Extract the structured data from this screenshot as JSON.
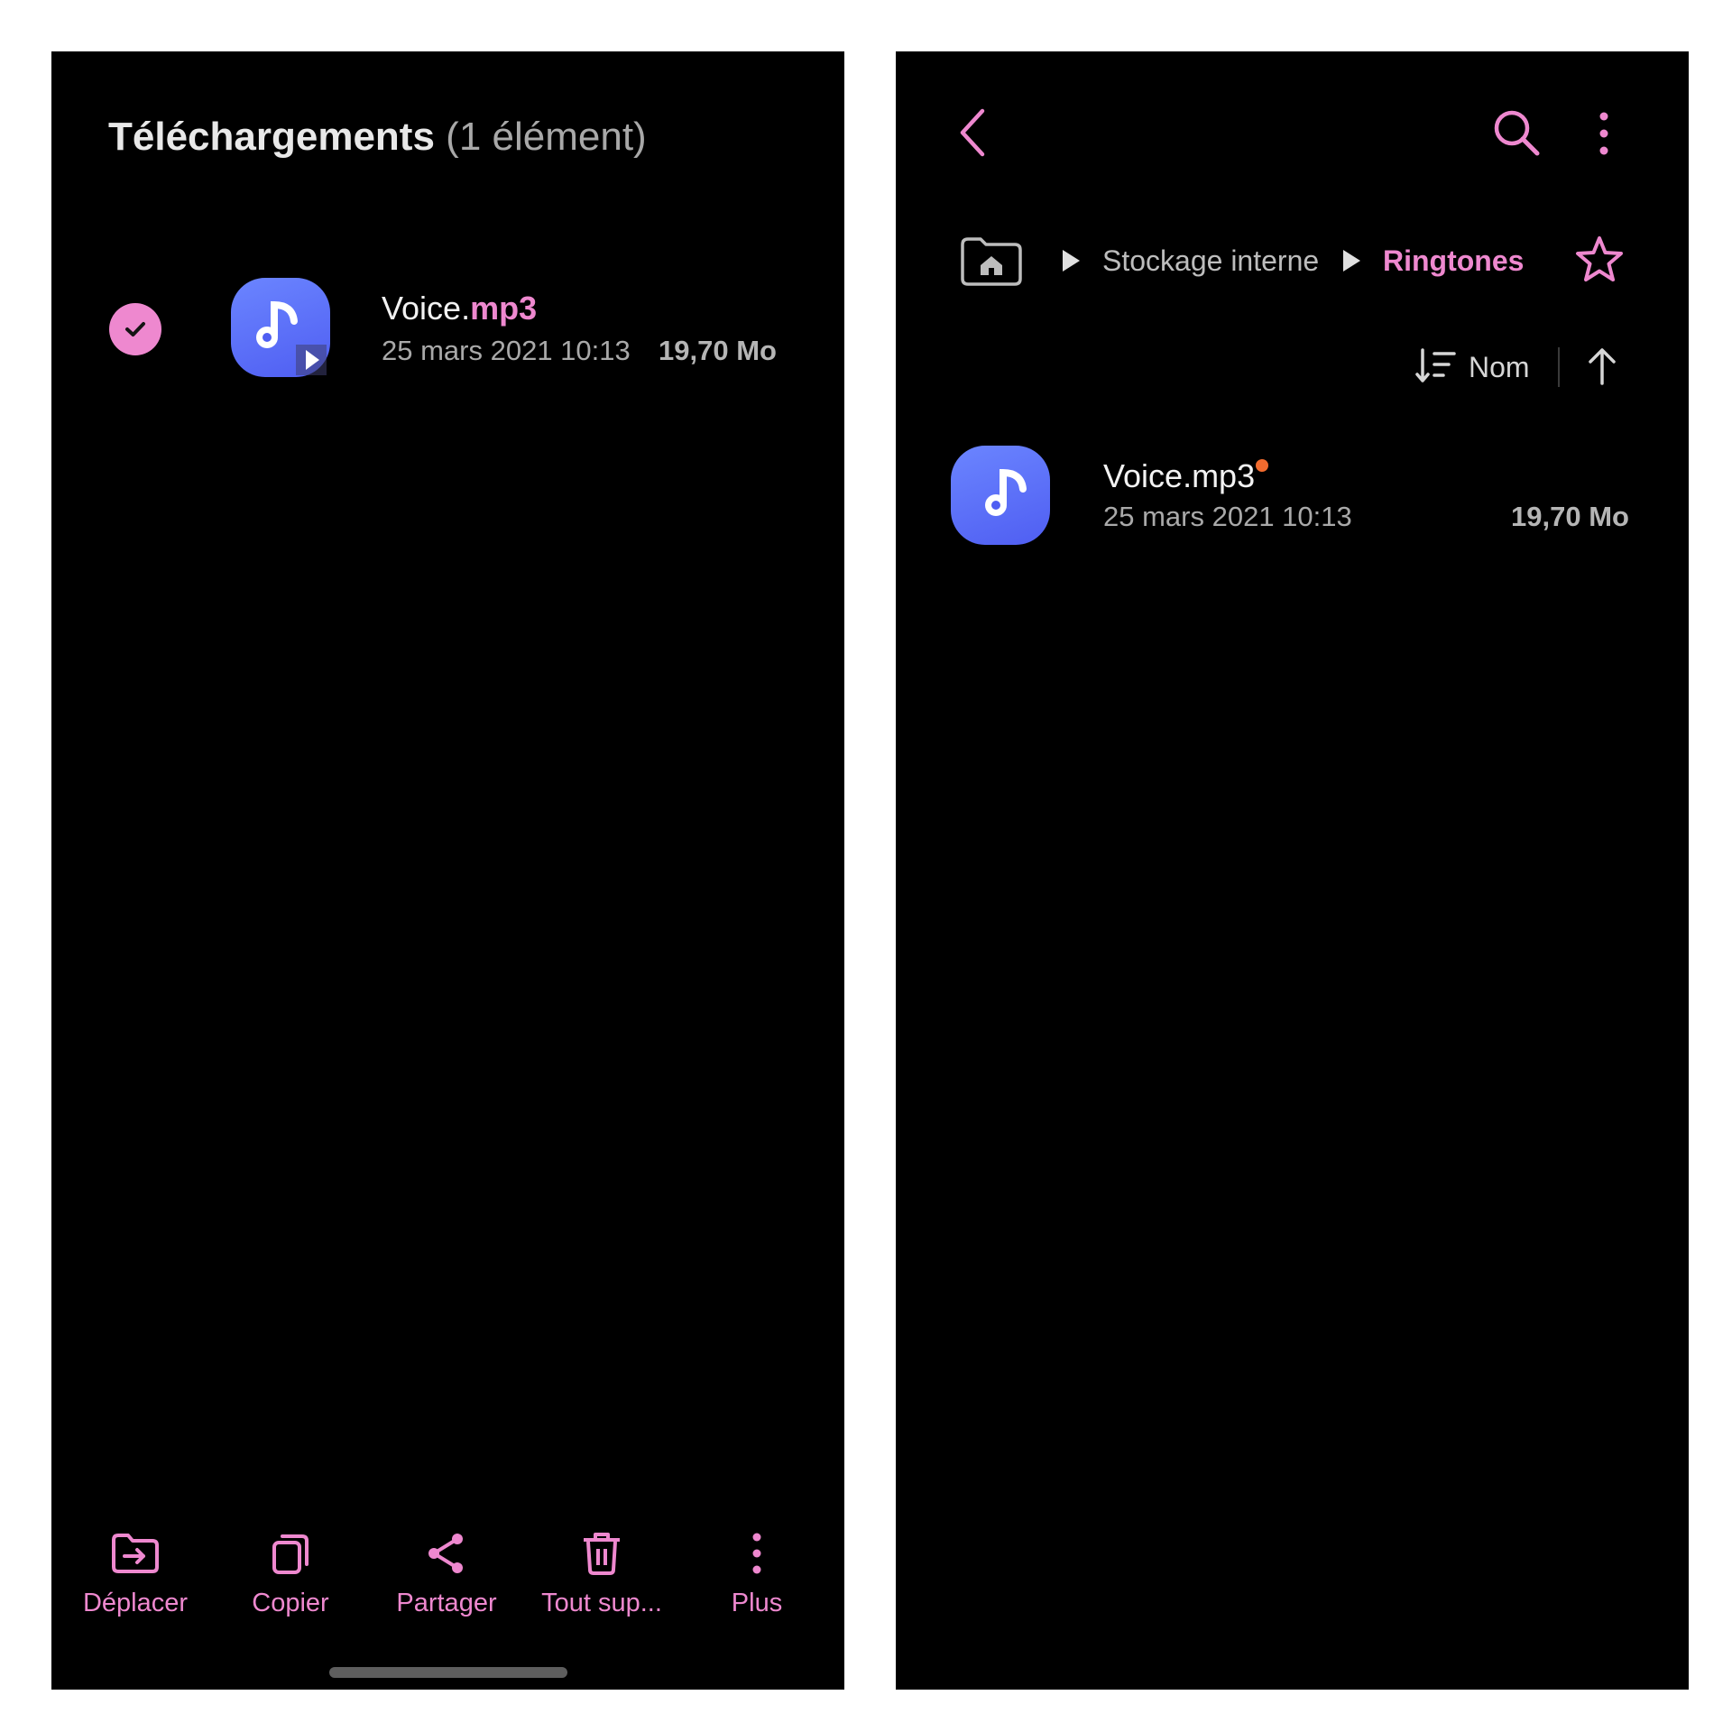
{
  "colors": {
    "accent": "#ee88cf",
    "background": "#000000",
    "app_icon": "#5b6cf7",
    "new_badge": "#f26b2e"
  },
  "left": {
    "title_main": "Téléchargements",
    "title_count": "(1 élément)",
    "file": {
      "name_base": "Voice.",
      "name_ext": "mp3",
      "date": "25 mars 2021 10:13",
      "size": "19,70 Mo",
      "selected": true,
      "icon": "music-note-icon"
    },
    "toolbar": [
      {
        "label": "Déplacer",
        "icon": "move-folder-icon"
      },
      {
        "label": "Copier",
        "icon": "copy-icon"
      },
      {
        "label": "Partager",
        "icon": "share-icon"
      },
      {
        "label": "Tout sup...",
        "icon": "trash-icon"
      },
      {
        "label": "Plus",
        "icon": "more-vert-icon"
      }
    ]
  },
  "right": {
    "icons": [
      "back-icon",
      "search-icon",
      "more-vert-icon",
      "home-folder-icon",
      "star-icon",
      "sort-icon",
      "arrow-up-icon"
    ],
    "breadcrumb": [
      "Stockage interne",
      "Ringtones"
    ],
    "sort_label": "Nom",
    "file": {
      "name": "Voice.mp3",
      "date": "25 mars 2021 10:13",
      "size": "19,70 Mo",
      "new": true,
      "icon": "music-note-icon"
    }
  }
}
